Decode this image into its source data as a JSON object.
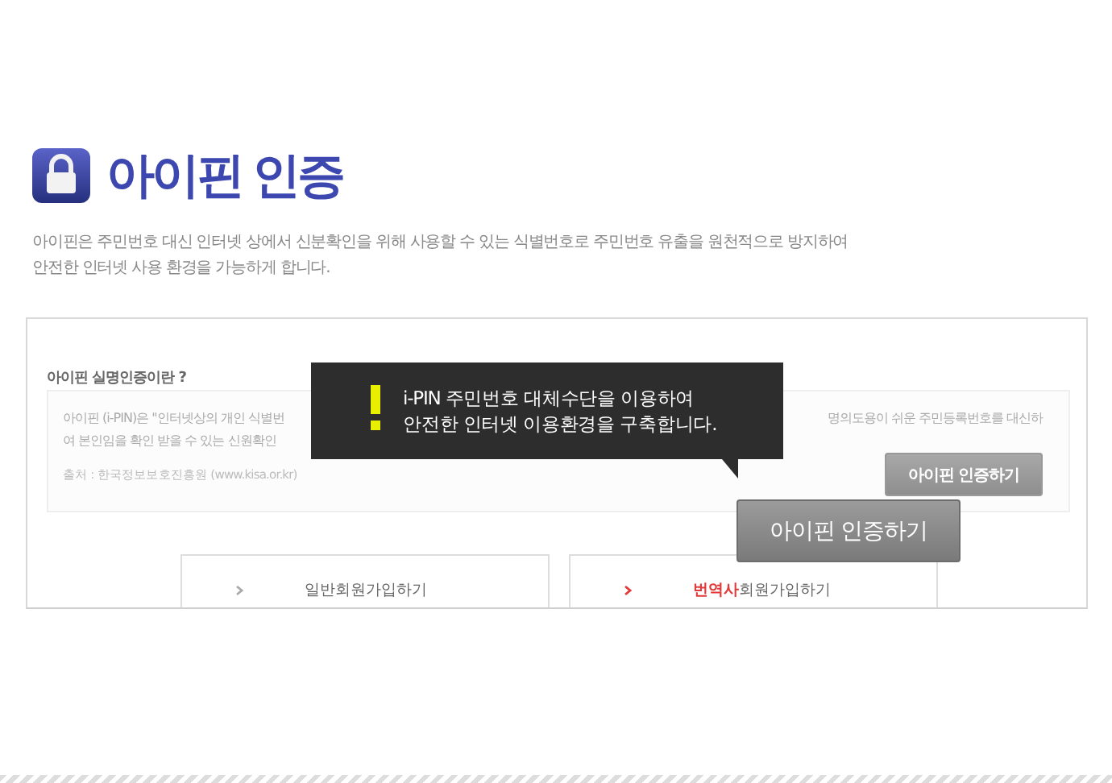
{
  "header": {
    "title": "아이핀 인증",
    "description": [
      "아이핀은 주민번호 대신 인터넷 상에서 신분확인을 위해 사용할 수 있는 식별번호로 주민번호 유출을 원천적으로 방지하여",
      "안전한 인터넷 사용 환경을 가능하게 합니다."
    ]
  },
  "info_panel": {
    "heading": "아이핀 실명인증이란 ?",
    "line_1_left": "아이핀 (i-PIN)은 \"인터넷상의 개인 식별번",
    "line_1_right": "명의도용이 쉬운 주민등록번호를 대신하",
    "line_2": "여 본인임을 확인 받을 수 있는 신원확인",
    "source": "출처 : 한국정보보호진흥원 (www.kisa.or.kr)",
    "button": "아이핀 인증하기"
  },
  "tooltip": {
    "lines": [
      "i-PIN 주민번호 대체수단을 이용하여",
      "안전한 인터넷 이용환경을 구축합니다."
    ],
    "button": "아이핀 인증하기"
  },
  "join_cards": [
    {
      "kind": "plain",
      "label": "일반회원가입하기"
    },
    {
      "kind": "accent",
      "highlight": "번역사",
      "label": "회원가입하기"
    }
  ]
}
